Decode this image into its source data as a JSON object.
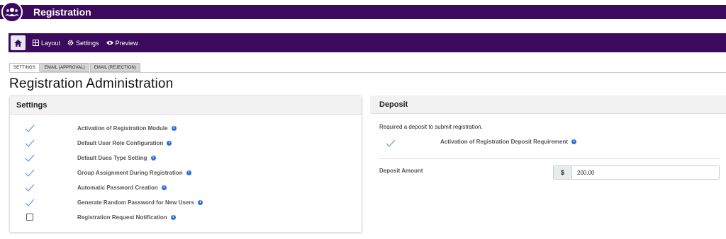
{
  "app": {
    "title": "Registration",
    "logo_icon": "users-icon"
  },
  "toolbar": {
    "home_icon": "home-icon",
    "items": [
      {
        "label": "Layout",
        "icon": "grid-icon"
      },
      {
        "label": "Settings",
        "icon": "gear-icon"
      },
      {
        "label": "Preview",
        "icon": "eye-icon"
      }
    ]
  },
  "tabs": [
    {
      "label": "SETTINGS",
      "active": true
    },
    {
      "label": "EMAIL (APPROVAL)",
      "active": false
    },
    {
      "label": "EMAIL (REJECTION)",
      "active": false
    }
  ],
  "page_title": "Registration Administration",
  "settings_panel": {
    "title": "Settings",
    "items": [
      {
        "label": "Activation of Registration Module",
        "checked": true
      },
      {
        "label": "Default User Role Configuration",
        "checked": true
      },
      {
        "label": "Default Dues Type Setting",
        "checked": true
      },
      {
        "label": "Group Assignment During Registration",
        "checked": true
      },
      {
        "label": "Automatic Password Creation",
        "checked": true
      },
      {
        "label": "Generate Random Password for New Users",
        "checked": true
      },
      {
        "label": "Registration Request Notification",
        "checked": false
      }
    ]
  },
  "deposit_panel": {
    "title": "Deposit",
    "description": "Required a deposit to submit registration.",
    "requirement_label": "Activation of Registration Deposit Requirement",
    "requirement_checked": true,
    "amount_label": "Deposit Amount",
    "currency_symbol": "$",
    "amount_value": "200.00"
  },
  "colors": {
    "brand": "#3b0a5c",
    "info": "#2a6fd6",
    "check": "#4a8fd9"
  }
}
